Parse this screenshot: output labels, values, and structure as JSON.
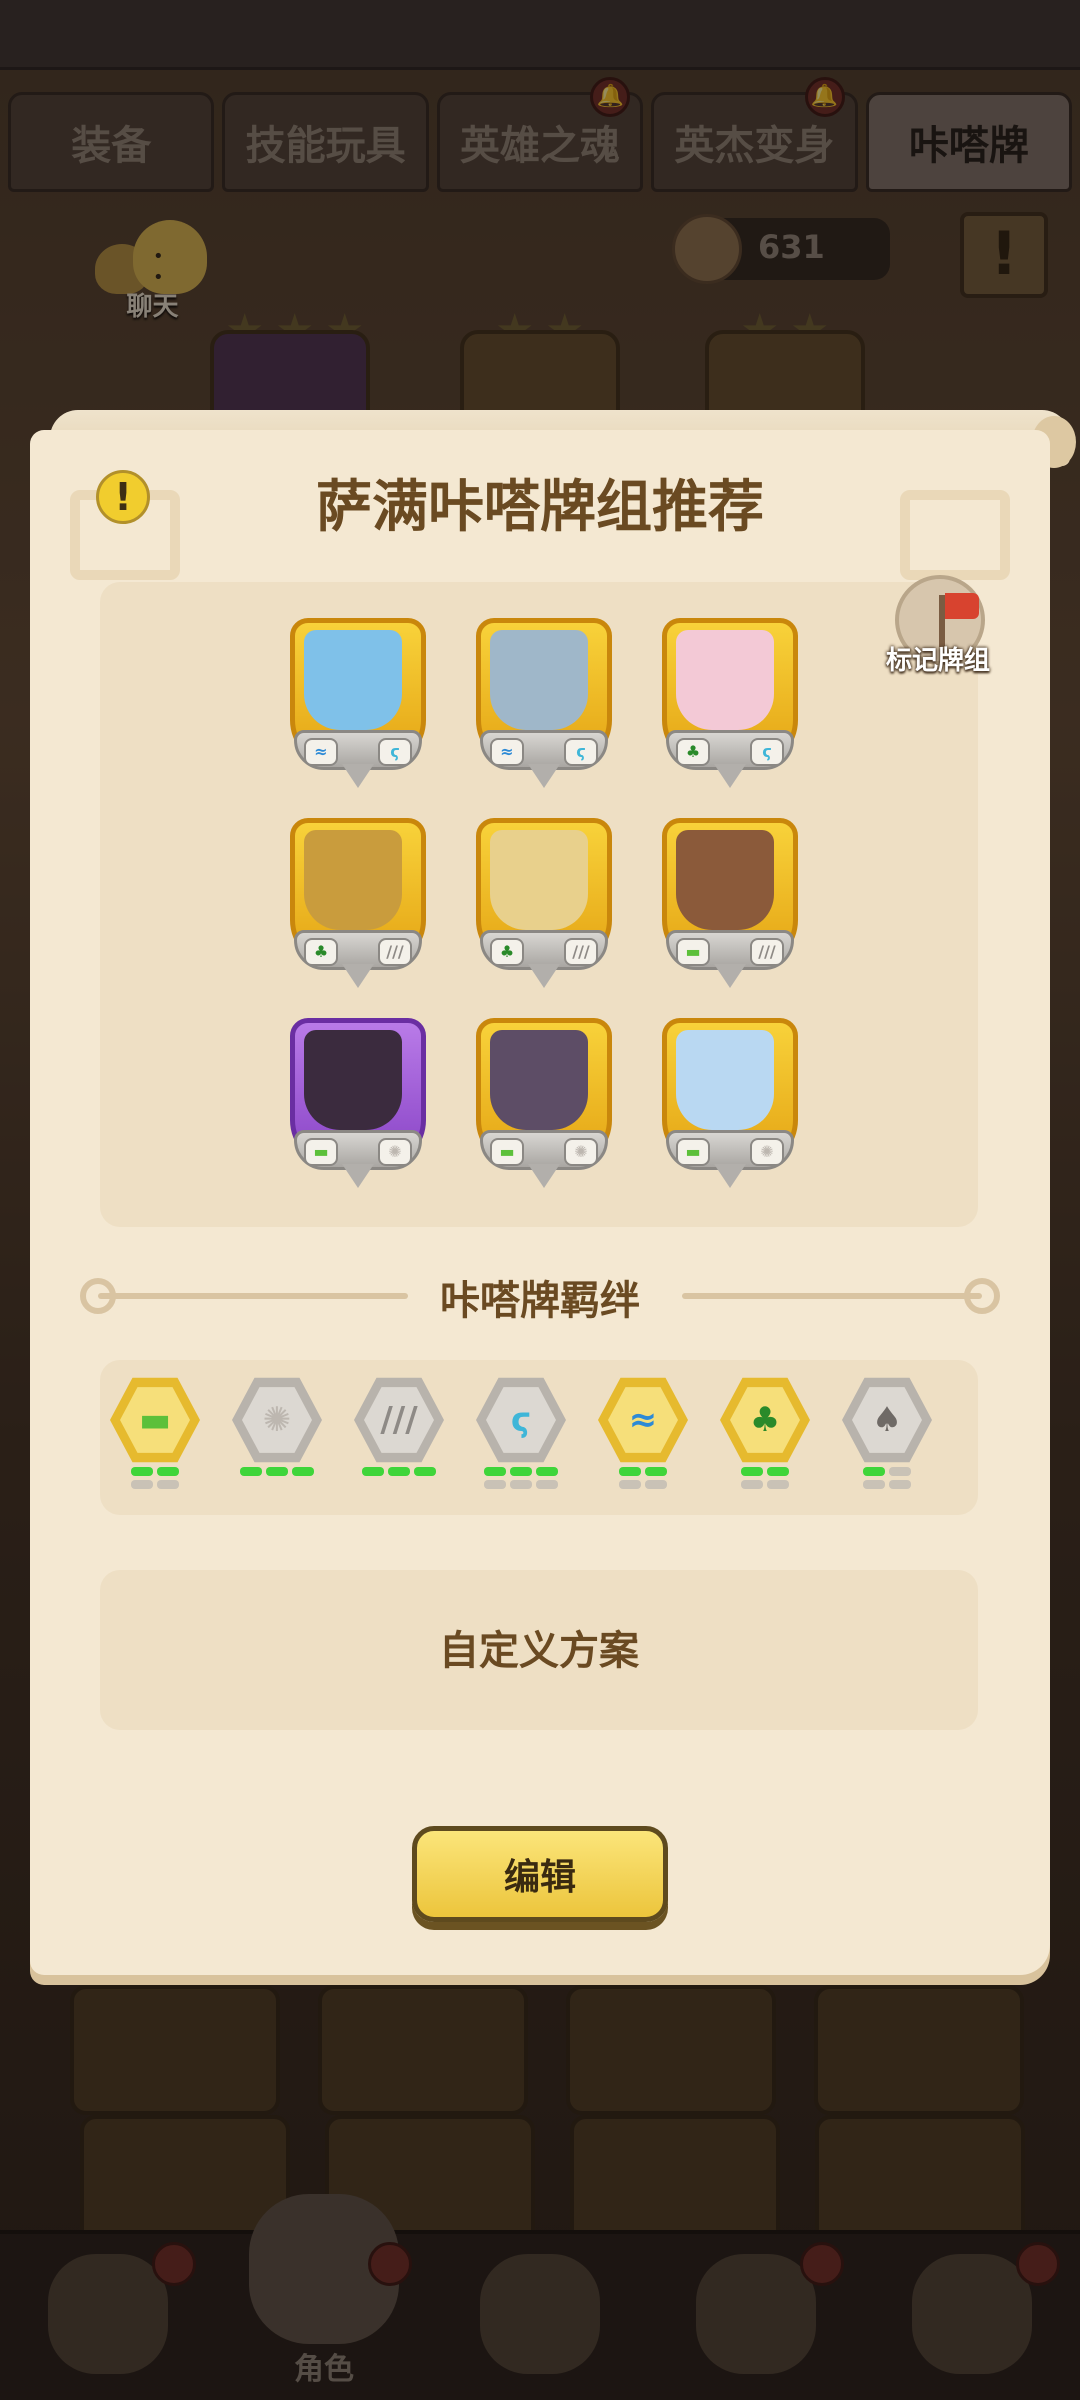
{
  "tabs": [
    {
      "label": "装备",
      "has_alert": false
    },
    {
      "label": "技能玩具",
      "has_alert": false
    },
    {
      "label": "英雄之魂",
      "has_alert": true
    },
    {
      "label": "英杰变身",
      "has_alert": true
    },
    {
      "label": "咔嗒牌",
      "has_alert": false,
      "active": true
    }
  ],
  "chat": {
    "label": "聊天"
  },
  "currency": {
    "value": "631"
  },
  "modal": {
    "title": "萨满咔嗒牌组推荐",
    "mark_button_label": "标记牌组",
    "bond_section_title": "咔嗒牌羁绊",
    "custom_plan_label": "自定义方案",
    "edit_button_label": "编辑"
  },
  "deck_cards": [
    {
      "frame": "gold",
      "art_color": "#7fc1e9",
      "left_badge": "water-icon",
      "right_badge": "wing-icon"
    },
    {
      "frame": "gold",
      "art_color": "#9fb7c9",
      "left_badge": "water-icon",
      "right_badge": "wing-icon"
    },
    {
      "frame": "gold",
      "art_color": "#f3c9d6",
      "left_badge": "tree-icon",
      "right_badge": "wing-icon"
    },
    {
      "frame": "gold",
      "art_color": "#c99c3d",
      "left_badge": "tree-icon",
      "right_badge": "claw-icon"
    },
    {
      "frame": "gold",
      "art_color": "#e8d08c",
      "left_badge": "tree-icon",
      "right_badge": "claw-icon"
    },
    {
      "frame": "gold",
      "art_color": "#8b5a3a",
      "left_badge": "grass-icon",
      "right_badge": "claw-icon"
    },
    {
      "frame": "purple",
      "art_color": "#3b2b3e",
      "left_badge": "grass-icon",
      "right_badge": "fur-icon"
    },
    {
      "frame": "gold",
      "art_color": "#5d4d66",
      "left_badge": "grass-icon",
      "right_badge": "fur-icon"
    },
    {
      "frame": "gold",
      "art_color": "#b9d8f2",
      "left_badge": "grass-icon",
      "right_badge": "fur-icon"
    }
  ],
  "bonds": [
    {
      "icon": "grass-icon",
      "active": true,
      "pips": [
        [
          true,
          true
        ],
        [
          false,
          false
        ]
      ]
    },
    {
      "icon": "fur-icon",
      "active": false,
      "pips": [
        [
          true,
          true,
          true
        ]
      ]
    },
    {
      "icon": "claw-icon",
      "active": false,
      "pips": [
        [
          true,
          true,
          true
        ]
      ]
    },
    {
      "icon": "wing-icon",
      "active": false,
      "pips": [
        [
          true,
          true,
          true
        ],
        [
          false,
          false,
          false
        ]
      ]
    },
    {
      "icon": "water-icon",
      "active": true,
      "pips": [
        [
          true,
          true
        ],
        [
          false,
          false
        ]
      ]
    },
    {
      "icon": "tree-icon",
      "active": true,
      "pips": [
        [
          true,
          true
        ],
        [
          false,
          false
        ]
      ]
    },
    {
      "icon": "palm-tree-icon",
      "active": false,
      "pips": [
        [
          true,
          false
        ],
        [
          false,
          false
        ]
      ]
    }
  ],
  "bottom_nav": [
    {
      "label": "",
      "has_alert": true
    },
    {
      "label": "角色",
      "has_alert": true,
      "active": true
    },
    {
      "label": "",
      "has_alert": false
    },
    {
      "label": "",
      "has_alert": true
    },
    {
      "label": "",
      "has_alert": true
    }
  ],
  "colors": {
    "parchment": "#f4e8d2",
    "title_brown": "#6a4a22",
    "gold_frame": "#f8d23a",
    "purple_frame": "#b97be8",
    "pip_on": "#3fd53a",
    "edit_button": "#f4d75a"
  }
}
